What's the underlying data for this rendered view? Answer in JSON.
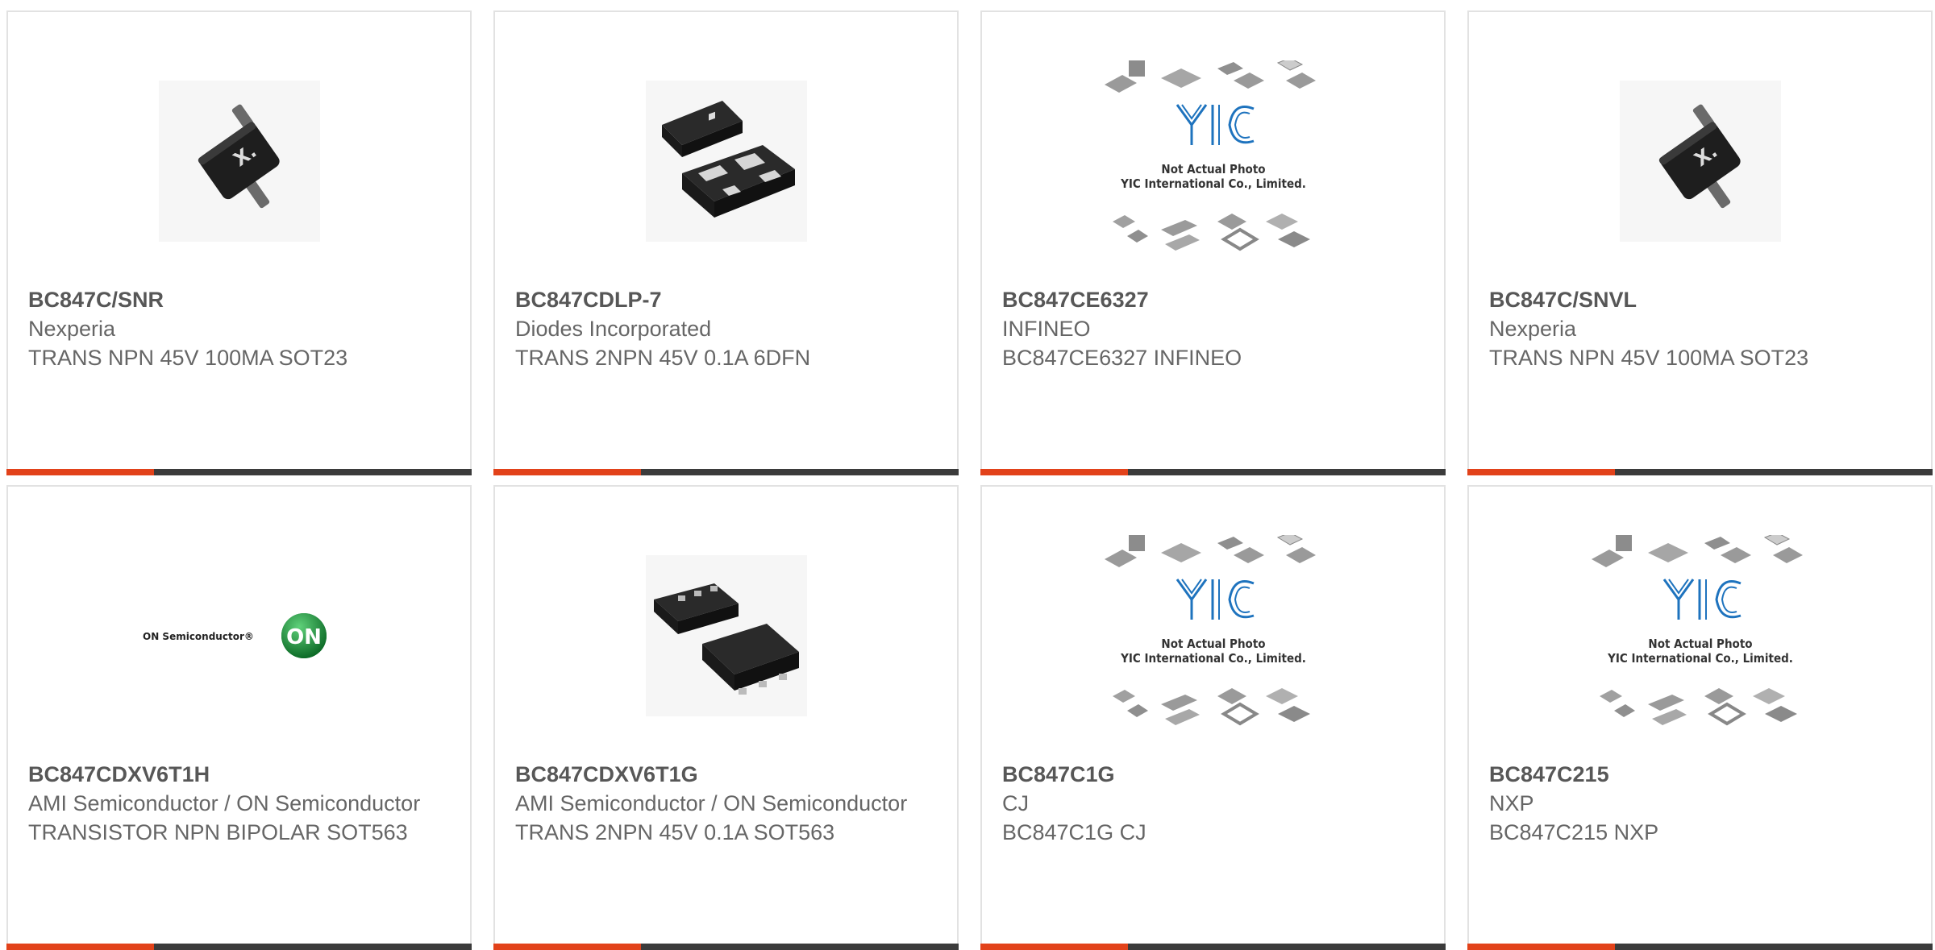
{
  "products": [
    {
      "part": "BC847C/SNR",
      "manufacturer": "Nexperia",
      "description": "TRANS NPN 45V 100MA SOT23",
      "image": "sot23-chip-icon"
    },
    {
      "part": "BC847CDLP-7",
      "manufacturer": "Diodes Incorporated",
      "description": "TRANS 2NPN 45V 0.1A 6DFN",
      "image": "dfn-package-icon"
    },
    {
      "part": "BC847CE6327",
      "manufacturer": "INFINEO",
      "description": "BC847CE6327 INFINEO",
      "image": "placeholder-photo-icon"
    },
    {
      "part": "BC847C/SNVL",
      "manufacturer": "Nexperia",
      "description": "TRANS NPN 45V 100MA SOT23",
      "image": "sot23-chip-icon"
    },
    {
      "part": "BC847CDXV6T1H",
      "manufacturer": "AMI Semiconductor / ON Semiconductor",
      "description": "TRANSISTOR NPN BIPOLAR SOT563",
      "image": "on-semi-logo"
    },
    {
      "part": "BC847CDXV6T1G",
      "manufacturer": "AMI Semiconductor / ON Semiconductor",
      "description": "TRANS 2NPN 45V 0.1A SOT563",
      "image": "sot563-package-icon"
    },
    {
      "part": "BC847C1G",
      "manufacturer": "CJ",
      "description": "BC847C1G CJ",
      "image": "placeholder-photo-icon"
    },
    {
      "part": "BC847C215",
      "manufacturer": "NXP",
      "description": "BC847C215 NXP",
      "image": "placeholder-photo-icon"
    }
  ],
  "placeholder": {
    "logo": "YIC",
    "line1": "Not Actual Photo",
    "line2": "YIC International Co., Limited."
  },
  "on_logo": {
    "text": "ON Semiconductor®",
    "badge": "ON"
  },
  "colors": {
    "accent": "#e2421a",
    "bar": "#3b3b3b",
    "title": "#575757",
    "text": "#666666"
  }
}
